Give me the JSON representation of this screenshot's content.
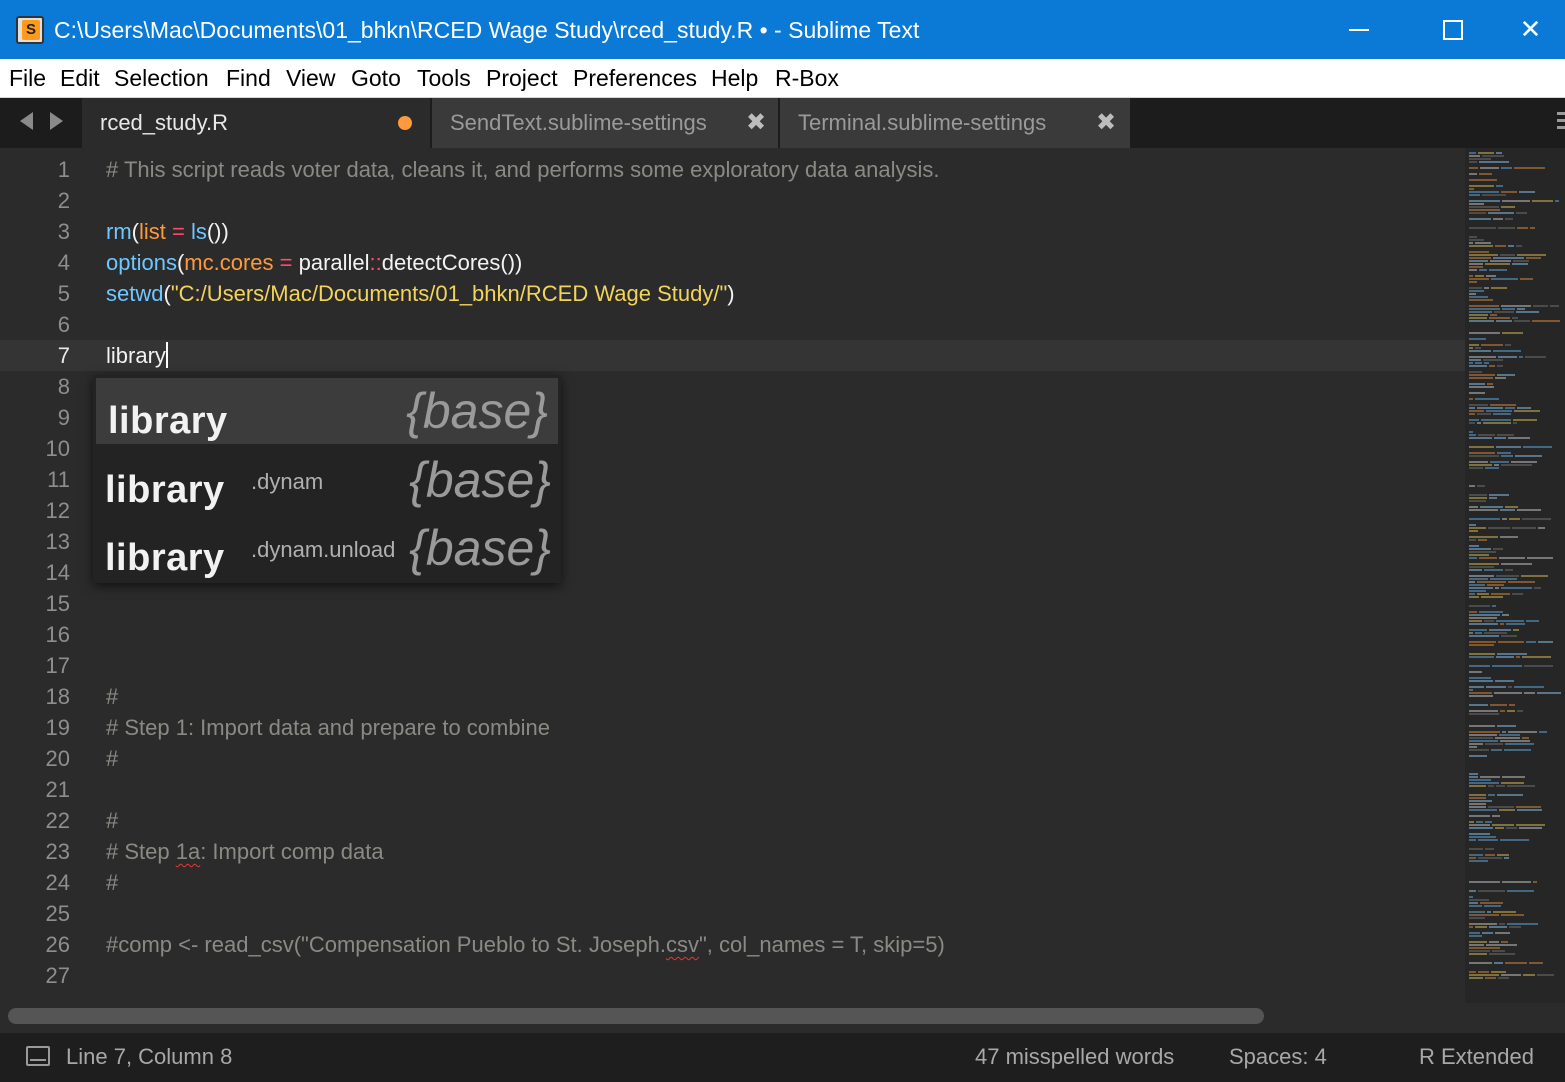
{
  "window": {
    "title": "C:\\Users\\Mac\\Documents\\01_bhkn\\RCED Wage Study\\rced_study.R • - Sublime Text",
    "minimize_glyph": "—",
    "maximize_glyph": "☐",
    "close_glyph": "✕"
  },
  "menu": [
    "File",
    "Edit",
    "Selection",
    "Find",
    "View",
    "Goto",
    "Tools",
    "Project",
    "Preferences",
    "Help",
    "R-Box"
  ],
  "tabs": [
    {
      "label": "rced_study.R",
      "modified": true
    },
    {
      "label": "SendText.sublime-settings",
      "close": "✖"
    },
    {
      "label": "Terminal.sublime-settings",
      "close": "✖"
    }
  ],
  "editor": {
    "line_numbers": [
      "1",
      "2",
      "3",
      "4",
      "5",
      "6",
      "7",
      "8",
      "9",
      "10",
      "11",
      "12",
      "13",
      "14",
      "15",
      "16",
      "17",
      "18",
      "19",
      "20",
      "21",
      "22",
      "23",
      "24",
      "25",
      "26",
      "27"
    ],
    "line1": "# This script reads voter data, cleans it, and performs some exploratory data analysis.",
    "line3": {
      "fn": "rm",
      "p1": "(",
      "arg": "list",
      "op": " = ",
      "fn2": "ls",
      "p2": "())"
    },
    "line4": {
      "fn": "options",
      "p1": "(",
      "arg": "mc.cores",
      "op": " = ",
      "pkg": "parallel",
      "ns": "::",
      "call": "detectCores",
      "p2": "())"
    },
    "line5": {
      "fn": "setwd",
      "p1": "(",
      "str": "\"C:/Users/Mac/Documents/01_bhkn/RCED Wage Study/\"",
      "p2": ")"
    },
    "line7": "library",
    "line18": "#",
    "line19": "# Step 1: Import data and prepare to combine",
    "line20": "#",
    "line22": "#",
    "line23": {
      "pre": "# Step ",
      "sq": "1a",
      "post": ": Import comp data"
    },
    "line24": "#",
    "line26": {
      "pre": "#comp <- read_csv(\"Compensation Pueblo to St. Joseph.",
      "sq": "csv",
      "post": "\", col_names = T, skip=5)"
    }
  },
  "autocomplete": [
    {
      "name": "library",
      "suffix": "",
      "kind": "{base}"
    },
    {
      "name": "library",
      "suffix": ".dynam",
      "kind": "{base}"
    },
    {
      "name": "library",
      "suffix": ".dynam.unload",
      "kind": "{base}"
    }
  ],
  "status": {
    "position": "Line 7, Column 8",
    "spell": "47 misspelled words",
    "indent": "Spaces: 4",
    "syntax": "R Extended"
  },
  "colors": {
    "titlebar": "#0a7ad6",
    "editor_bg": "#2b2b2b",
    "comment": "#8a8a85",
    "function": "#6ec7ff",
    "parameter": "#ff9a3c",
    "operator": "#ff4a6d",
    "string": "#f2d45a"
  }
}
